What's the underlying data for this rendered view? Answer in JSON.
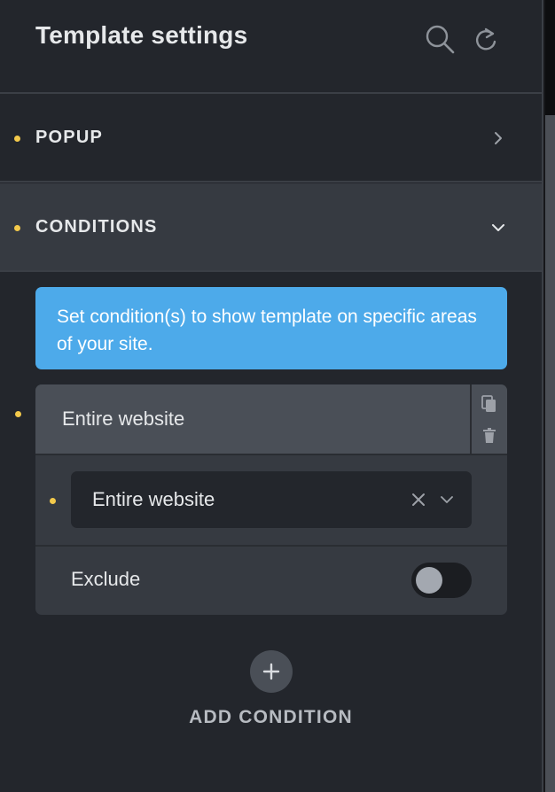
{
  "header": {
    "title": "Template settings",
    "icons": [
      "search-icon",
      "refresh-icon"
    ]
  },
  "sections": [
    {
      "label": "POPUP",
      "state": "collapsed"
    },
    {
      "label": "CONDITIONS",
      "state": "expanded"
    }
  ],
  "conditions": {
    "info_text": "Set condition(s) to show template on specific areas of your site.",
    "items": [
      {
        "title": "Entire website",
        "select_value": "Entire website",
        "exclude_label": "Exclude",
        "exclude_enabled": false
      }
    ],
    "add_label": "ADD CONDITION"
  },
  "colors": {
    "background": "#23262c",
    "section_active": "#363a41",
    "info": "#4daaea",
    "indicator_dot": "#f3c94b"
  }
}
